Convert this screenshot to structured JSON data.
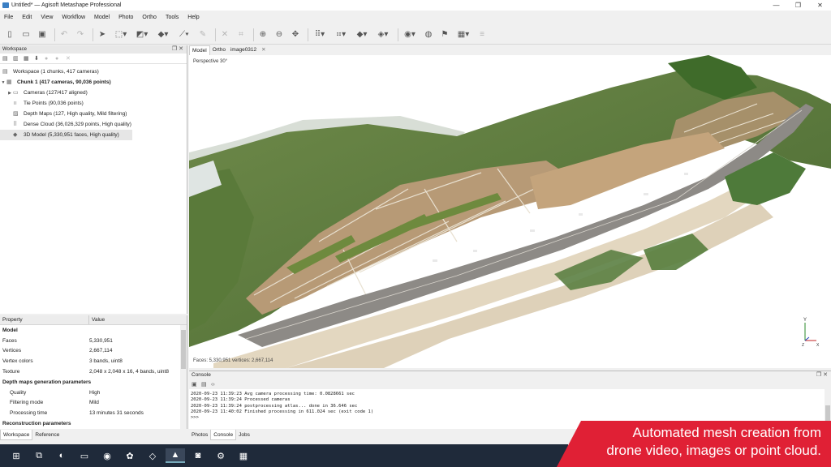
{
  "window": {
    "title": "Untitled* — Agisoft Metashape Professional",
    "min": "—",
    "max": "❐",
    "close": "✕"
  },
  "menu": [
    "File",
    "Edit",
    "View",
    "Workflow",
    "Model",
    "Photo",
    "Ortho",
    "Tools",
    "Help"
  ],
  "workspace": {
    "panel_title": "Workspace",
    "root": "Workspace (1 chunks, 417 cameras)",
    "chunk": "Chunk 1 (417 cameras, 90,036 points)",
    "items": [
      {
        "label": "Cameras (127/417 aligned)",
        "icon": "folder-icon"
      },
      {
        "label": "Tie Points (90,036 points)",
        "icon": "tie-points-icon"
      },
      {
        "label": "Depth Maps (127, High quality, Mild filtering)",
        "icon": "depth-maps-icon"
      },
      {
        "label": "Dense Cloud (36,026,329 points, High quality)",
        "icon": "dense-cloud-icon"
      },
      {
        "label": "3D Model (5,330,951 faces, High quality)",
        "icon": "mesh-icon"
      }
    ]
  },
  "properties": {
    "col_property": "Property",
    "col_value": "Value",
    "model_section": "Model",
    "rows": [
      {
        "k": "Faces",
        "v": "5,330,951"
      },
      {
        "k": "Vertices",
        "v": "2,667,114"
      },
      {
        "k": "Vertex colors",
        "v": "3 bands, uint8"
      },
      {
        "k": "Texture",
        "v": "2,048 x 2,048 x 16, 4 bands, uint8"
      }
    ],
    "depth_section": "Depth maps generation parameters",
    "depth_rows": [
      {
        "k": "Quality",
        "v": "High"
      },
      {
        "k": "Filtering mode",
        "v": "Mild"
      },
      {
        "k": "Processing time",
        "v": "13 minutes 31 seconds"
      }
    ],
    "recon_section": "Reconstruction parameters"
  },
  "left_tabs": [
    "Workspace",
    "Reference"
  ],
  "view_tabs": [
    "Model",
    "Ortho",
    "image0312"
  ],
  "viewport": {
    "projection": "Perspective 30°",
    "stats": "Faces: 5,330,951 vertices: 2,667,114",
    "axis_y": "Y",
    "axis_z": "Z",
    "axis_x": "X"
  },
  "console": {
    "title": "Console",
    "lines": [
      "2020-09-23 11:39:23 Avg camera processing time: 0.0828661 sec",
      "2020-09-23 11:39:24 Processed cameras",
      "2020-09-23 11:39:24 postprocessing atlas... done in 36.646 sec",
      "2020-09-23 11:40:02 Finished processing in 611.024 sec (exit code 1)",
      ">>>"
    ]
  },
  "console_tabs": [
    "Photos",
    "Console",
    "Jobs"
  ],
  "banner": {
    "line1": "Automated mesh creation from",
    "line2": "drone video, images or point cloud.",
    "color": "#e02035"
  }
}
